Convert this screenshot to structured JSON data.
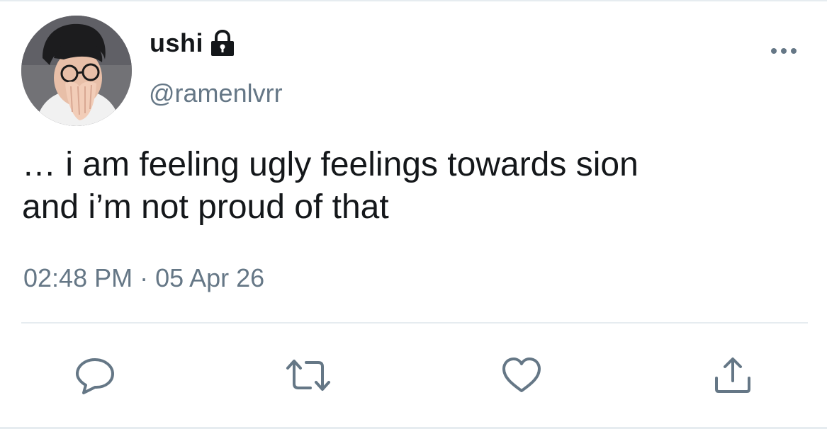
{
  "tweet": {
    "author": {
      "display_name": "ushi",
      "handle": "@ramenlvrr",
      "protected_icon": "lock-icon",
      "avatar": "avatar"
    },
    "more_icon": "more-horizontal-icon",
    "text_lines": [
      "… i am feeling ugly feelings towards sion",
      "and i’m not proud of that"
    ],
    "timestamp": "02:48 PM · 05 Apr 26",
    "actions": [
      {
        "name": "reply",
        "icon": "reply-icon"
      },
      {
        "name": "retweet",
        "icon": "retweet-icon"
      },
      {
        "name": "like",
        "icon": "heart-icon"
      },
      {
        "name": "share",
        "icon": "share-icon"
      }
    ],
    "colors": {
      "text_primary": "#14171a",
      "text_secondary": "#657786",
      "divider": "#e6ecf0"
    }
  }
}
